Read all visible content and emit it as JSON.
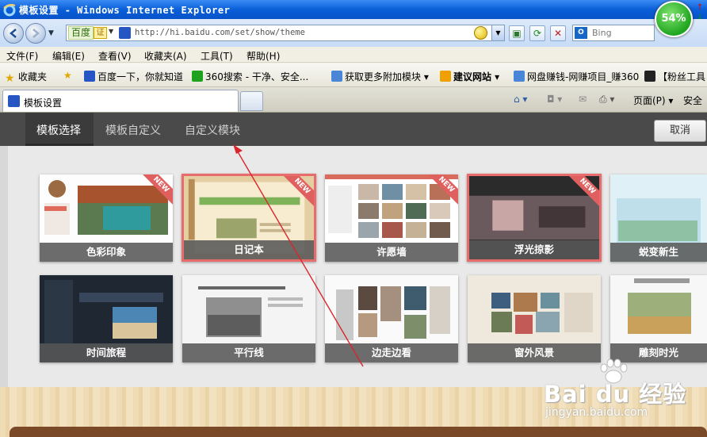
{
  "window": {
    "title": "模板设置 - Windows Internet Explorer",
    "progress_badge": "54%"
  },
  "address_bar": {
    "brand_label": "百度",
    "cert_label": "证",
    "url": "http://hi.baidu.com/set/show/theme",
    "search_placeholder": "Bing"
  },
  "menu": [
    "文件(F)",
    "编辑(E)",
    "查看(V)",
    "收藏夹(A)",
    "工具(T)",
    "帮助(H)"
  ],
  "favorites": {
    "label": "收藏夹",
    "items": [
      "百度一下，你就知道",
      "360搜索 - 干净、安全...",
      "获取更多附加模块 ▾",
      "建议网站 ▾",
      "网盘赚钱-网赚项目_赚360",
      "【粉丝工具"
    ]
  },
  "tabs": {
    "active_tab": "模板设置",
    "commands": [
      "页面(P) ▾",
      "安全"
    ]
  },
  "page": {
    "tabs": [
      "模板选择",
      "模板自定义",
      "自定义模块"
    ],
    "active_tab_index": 0,
    "cancel_label": "取消",
    "new_badge": "NEW",
    "themes_row1": [
      "色彩印象",
      "日记本",
      "许愿墙",
      "浮光掠影",
      "蜕变新生"
    ],
    "themes_row2": [
      "时间旅程",
      "平行线",
      "边走边看",
      "窗外风景",
      "雕刻时光"
    ],
    "selected_themes": [
      "日记本",
      "浮光掠影"
    ],
    "new_themes": [
      "色彩印象",
      "日记本",
      "许愿墙",
      "浮光掠影"
    ]
  },
  "watermark": {
    "logo": "Bai du 经验",
    "url": "jingyan.baidu.com"
  },
  "colors": {
    "titlebar": "#0a5fd8",
    "page_header": "#4a4a4a",
    "selected_border": "#e86c6c",
    "annotation_arrow": "#d9262c"
  }
}
